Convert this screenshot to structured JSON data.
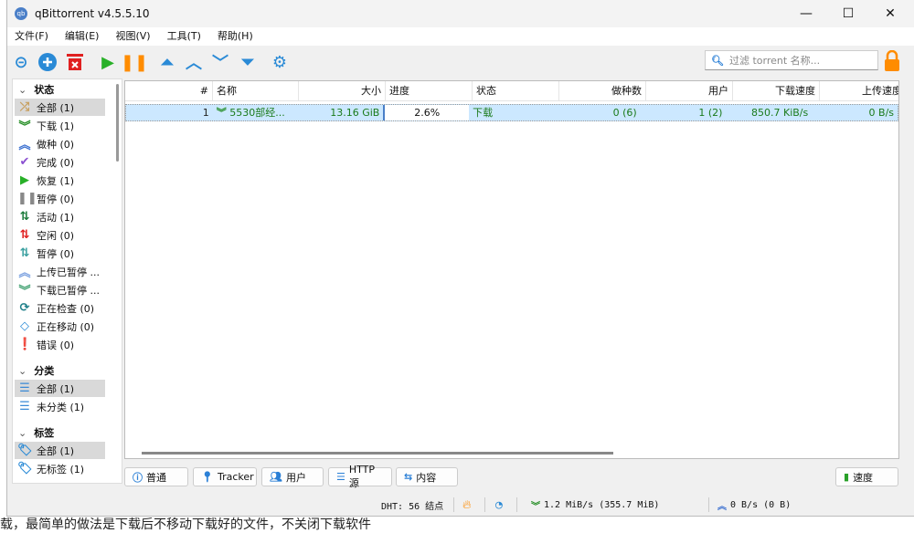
{
  "window": {
    "title": "qBittorrent v4.5.5.10",
    "logo": "qb"
  },
  "menu": [
    "文件(F)",
    "编辑(E)",
    "视图(V)",
    "工具(T)",
    "帮助(H)"
  ],
  "toolbar": {
    "icons": [
      "add-link-icon",
      "add-torrent-icon",
      "delete-icon",
      "resume-icon",
      "pause-icon",
      "move-top-icon",
      "move-up-icon",
      "move-down-icon",
      "move-bottom-icon",
      "options-icon"
    ]
  },
  "search": {
    "placeholder": "过滤 torrent 名称..."
  },
  "sidebar": {
    "status_header": "状态",
    "status": [
      {
        "label": "全部 (1)",
        "icon": "⤮",
        "color": "#c8a060"
      },
      {
        "label": "下载 (1)",
        "icon": "︾",
        "color": "#1e8a1e"
      },
      {
        "label": "做种 (0)",
        "icon": "︽",
        "color": "#3a6fd0"
      },
      {
        "label": "完成 (0)",
        "icon": "✔",
        "color": "#8a4fd0"
      },
      {
        "label": "恢复 (1)",
        "icon": "▶",
        "color": "#28b028"
      },
      {
        "label": "暂停 (0)",
        "icon": "❚❚",
        "color": "#888888"
      },
      {
        "label": "活动 (1)",
        "icon": "⇅",
        "color": "#1a7a3a"
      },
      {
        "label": "空闲 (0)",
        "icon": "⇅",
        "color": "#e02020"
      },
      {
        "label": "暂停 (0)",
        "icon": "⇅",
        "color": "#3aa0a0"
      },
      {
        "label": "上传已暂停 ...",
        "icon": "︽",
        "color": "#7aa0e0"
      },
      {
        "label": "下载已暂停 ...",
        "icon": "︾",
        "color": "#40a070"
      },
      {
        "label": "正在检查 (0)",
        "icon": "⟳",
        "color": "#20808a"
      },
      {
        "label": "正在移动 (0)",
        "icon": "◇",
        "color": "#2a8ad6"
      },
      {
        "label": "错误 (0)",
        "icon": "❗",
        "color": "#e01010"
      }
    ],
    "category_header": "分类",
    "categories": [
      "全部 (1)",
      "未分类 (1)"
    ],
    "tags_header": "标签",
    "tags": [
      "全部 (1)",
      "无标签 (1)"
    ]
  },
  "table": {
    "columns": [
      "#",
      "名称",
      "大小",
      "进度",
      "状态",
      "做种数",
      "用户",
      "下载速度",
      "上传速度"
    ],
    "rows": [
      {
        "num": "1",
        "name": "5530部经...",
        "size": "13.16 GiB",
        "progress": "2.6%",
        "progress_value": 2.6,
        "status": "下载",
        "seeds": "0 (6)",
        "peers": "1 (2)",
        "dl": "850.7 KiB/s",
        "ul": "0 B/s"
      }
    ]
  },
  "bottom_tabs": [
    "普通",
    "Tracker",
    "用户",
    "HTTP 源",
    "内容"
  ],
  "speed_tab": "速度",
  "statusbar": {
    "dht": "DHT: 56 结点",
    "download": "1.2 MiB/s (355.7 MiB)",
    "upload": "0 B/s (0 B)"
  },
  "background_text": "载，最简单的做法是下载后不移动下载好的文件，不关闭下载软件"
}
